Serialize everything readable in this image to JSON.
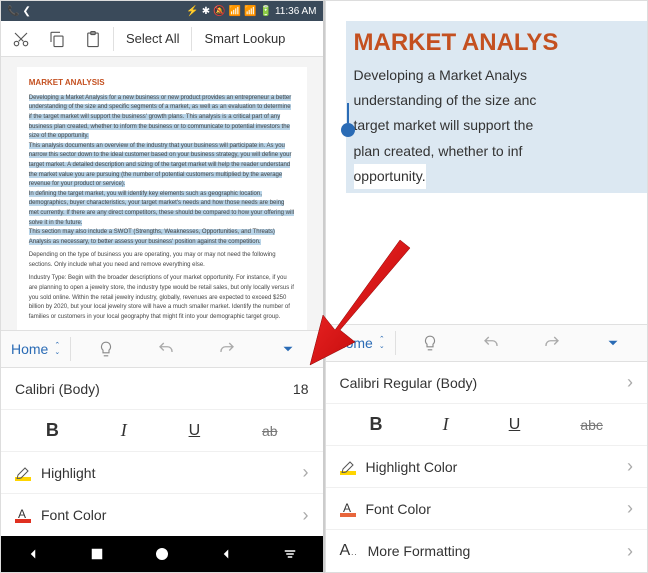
{
  "statusbar": {
    "time": "11:36 AM"
  },
  "topbar": {
    "select_all": "Select All",
    "smart_lookup": "Smart Lookup"
  },
  "ribbon": {
    "tab": "Home"
  },
  "font_row_left": {
    "name": "Calibri (Body)",
    "size": "18"
  },
  "font_row_right": {
    "name": "Calibri Regular (Body)"
  },
  "buttons": {
    "b": "B",
    "i": "I",
    "u": "U",
    "s_left": "ab",
    "s_right": "abc"
  },
  "rows": {
    "highlight_left": "Highlight",
    "font_color": "Font Color",
    "highlight_right": "Highlight Color",
    "more_fmt": "More Formatting"
  },
  "doc": {
    "heading": "MARKET ANALYSIS",
    "heading_right": "MARKET ANALYS",
    "p1": "Developing a Market Analysis for a new business or new product provides an entrepreneur a better understanding of the size and specific segments of a market, as well as an evaluation to determine if the target market will support the business' growth plans. This analysis is a critical part of any business plan created, whether to inform the business or to communicate to potential investors the size of the opportunity.",
    "p2": "This analysis documents an overview of the industry that your business will participate in. As you narrow this sector down to the ideal customer based on your business strategy, you will define your target market. A detailed description and sizing of the target market will help the reader understand the market value you are pursuing (the number of potential customers multiplied by the average revenue for your product or service).",
    "p3": "In defining the target market, you will identify key elements such as geographic location, demographics, buyer characteristics, your target market's needs and how those needs are being met currently. If there are any direct competitors, these should be compared to how your offering will solve it in the future.",
    "p4": "This section may also include a SWOT (Strengths, Weaknesses, Opportunities, and Threats) Analysis as necessary, to better assess your business' position against the competition.",
    "p5": "Depending on the type of business you are operating, you may or may not need the following sections. Only include what you need and remove everything else.",
    "p6": "Industry Type: Begin with the broader descriptions of your market opportunity. For instance, if you are planning to open a jewelry store, the industry type would be retail sales, but only locally versus if you sold online. Within the retail jewelry industry, globally, revenues are expected to exceed $250 billion by 2020, but your local jewelry store will have a much smaller market. Identify the number of families or customers in your local geography that might fit into your demographic target group.",
    "r1": "Developing a Market Analys",
    "r2": "understanding of the size anc",
    "r3": "target market will support the",
    "r4": "plan created, whether to inf",
    "r5": "opportunity."
  }
}
